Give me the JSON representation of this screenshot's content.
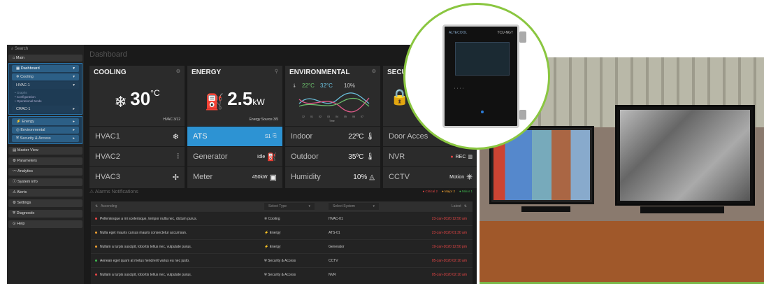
{
  "sidebar": {
    "search": "Search",
    "main": "Main",
    "dashboard": "Dashboard",
    "cooling": "Cooling",
    "hvac_select": "HVAC-1",
    "modes": [
      "Graphs",
      "Configuration",
      "Operational Mode"
    ],
    "crac_select": "CRAC-1",
    "energy": "Energy",
    "environmental": "Environmental",
    "security": "Security & Access",
    "items": [
      "Master View",
      "Parameters",
      "Analytics",
      "System info",
      "Alerts",
      "Settings",
      "Diagnostic",
      "Help"
    ]
  },
  "dashboard_title": "Dashboard",
  "cooling": {
    "title": "COOLING",
    "value": "30",
    "unit": "°C",
    "sublabel": "HVAC 3/12",
    "rows": [
      "HVAC1",
      "HVAC2",
      "HVAC3"
    ]
  },
  "energy": {
    "title": "ENERGY",
    "value": "2.5",
    "unit": "kW",
    "sublabel": "Energy Source 3/5",
    "rows": [
      {
        "label": "ATS",
        "value": "S1"
      },
      {
        "label": "Generator",
        "value": "Idle"
      },
      {
        "label": "Meter",
        "value": "450kW"
      }
    ]
  },
  "environmental": {
    "title": "ENVIRONMENTAL",
    "temp1": "22°C",
    "temp2": "32°C",
    "humidity_pct": "10%",
    "x_ticks": [
      "12",
      "01",
      "02",
      "03",
      "04",
      "05",
      "06",
      "07"
    ],
    "x_label": "Time",
    "rows": [
      {
        "label": "Indoor",
        "value": "22ºC"
      },
      {
        "label": "Outdoor",
        "value": "35ºC"
      },
      {
        "label": "Humidity",
        "value": "10%"
      }
    ]
  },
  "security": {
    "title": "SECU",
    "rows": [
      {
        "label": "Door Acces",
        "value": ""
      },
      {
        "label": "NVR",
        "value": "REC"
      },
      {
        "label": "CCTV",
        "value": "Motion"
      }
    ]
  },
  "alarms": {
    "title": "Alarms Notifications",
    "legend": [
      "Critical 2",
      "Major 2",
      "Minor 1"
    ],
    "sort": "Ascending",
    "select_type": "Select Type",
    "select_system": "Select System",
    "latest": "Latest",
    "rows": [
      {
        "msg": "Pellentesque a mi scelerisque, tempor nulla nec, dictum purus.",
        "type": "Cooling",
        "system": "HVAC-01",
        "date": "23-Jan-2020 12:50 am",
        "color": "#e84545"
      },
      {
        "msg": "Nulla eget mauris cursus mauris consectetur accumsan.",
        "type": "Energy",
        "system": "ATS-01",
        "date": "23-Jan-2020 01:30 am",
        "color": "#f0a030"
      },
      {
        "msg": "Nullam a turpis suscipit, lobortis tellus nec, vulputate purus.",
        "type": "Energy",
        "system": "Generator",
        "date": "19-Jan-2020 12:50 pm",
        "color": "#f0a030"
      },
      {
        "msg": "Aenean eget quam at metus hendrerit varius eu nec justo.",
        "type": "Security & Access",
        "system": "CCTV",
        "date": "05-Jan-2020 02:10 am",
        "color": "#3fb950"
      },
      {
        "msg": "Nullam a turpis suscipit, lobortis tellus nec, vulputate purus.",
        "type": "Security & Access",
        "system": "NVR",
        "date": "05-Jan-2020 02:10 am",
        "color": "#e84545"
      }
    ]
  },
  "device": {
    "brand": "ALTECOOL",
    "model": "TCU-NGT"
  }
}
